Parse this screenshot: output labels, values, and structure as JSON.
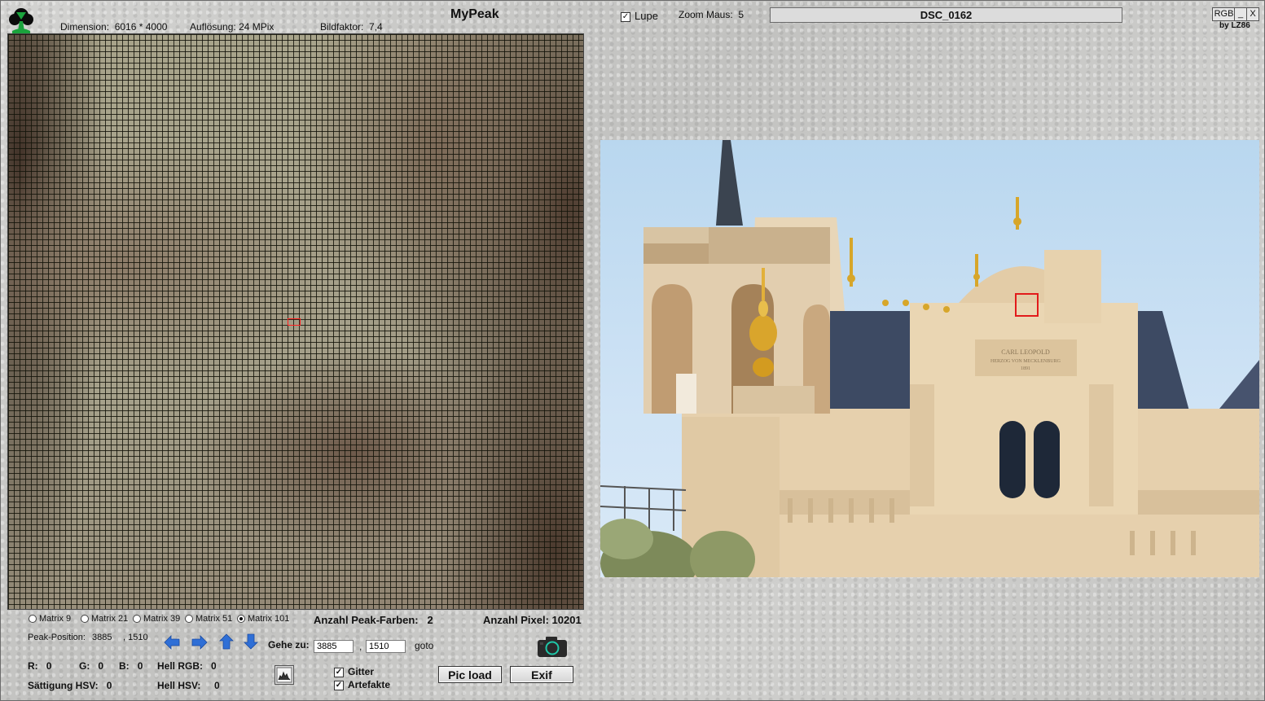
{
  "app": {
    "title": "MyPeak",
    "byline": "by LZ86"
  },
  "info": {
    "dimension_label": "Dimension:",
    "dimension_value": "6016 * 4000",
    "resolution_label": "Auflösung:",
    "resolution_value": "24 MPix",
    "factor_label": "Bildfaktor:",
    "factor_value": "7,4"
  },
  "toolbar": {
    "lupe_label": "Lupe",
    "lupe_checked": true,
    "zoom_label": "Zoom Maus:",
    "zoom_value": "5",
    "filename": "DSC_0162"
  },
  "window_buttons": {
    "rgb": "RGB",
    "minimize": "_",
    "close": "X"
  },
  "matrix_options": [
    {
      "label": "Matrix 9",
      "selected": false
    },
    {
      "label": "Matrix 21",
      "selected": false
    },
    {
      "label": "Matrix 39",
      "selected": false
    },
    {
      "label": "Matrix 51",
      "selected": false
    },
    {
      "label": "Matrix 101",
      "selected": true
    }
  ],
  "stats": {
    "peak_colors_label": "Anzahl Peak-Farben:",
    "peak_colors_value": "2",
    "pixel_count_label": "Anzahl Pixel:",
    "pixel_count_value": "10201"
  },
  "peak": {
    "label": "Peak-Position:",
    "x": "3885",
    "y": ", 1510"
  },
  "goto": {
    "label": "Gehe zu:",
    "x_value": "3885",
    "separator": ",",
    "y_value": "1510",
    "button": "goto"
  },
  "color_values": {
    "r_label": "R:",
    "r_value": "0",
    "g_label": "G:",
    "g_value": "0",
    "b_label": "B:",
    "b_value": "0",
    "hell_rgb_label": "Hell RGB:",
    "hell_rgb_value": "0",
    "saturation_label": "Sättigung HSV:",
    "saturation_value": "0",
    "hell_hsv_label": "Hell HSV:",
    "hell_hsv_value": "0"
  },
  "options": {
    "gitter_label": "Gitter",
    "gitter_checked": true,
    "artefakte_label": "Artefakte",
    "artefakte_checked": true
  },
  "buttons": {
    "pic_load": "Pic load",
    "exif": "Exif"
  },
  "photo": {
    "inscription_line1": "CARL LEOPOLD",
    "inscription_line2": "HERZOG VON MECKLENBURG",
    "inscription_line3": "1891"
  },
  "icons": {
    "logo": "tree-logo-icon",
    "arrows": [
      "arrow-left-icon",
      "arrow-right-icon",
      "arrow-up-icon",
      "arrow-down-icon"
    ],
    "camera": "camera-icon",
    "histogram": "histogram-icon"
  },
  "colors": {
    "accent_blue": "#2f6fd6",
    "marker_red": "#e21b1b",
    "camera_teal": "#1fc7a8"
  }
}
